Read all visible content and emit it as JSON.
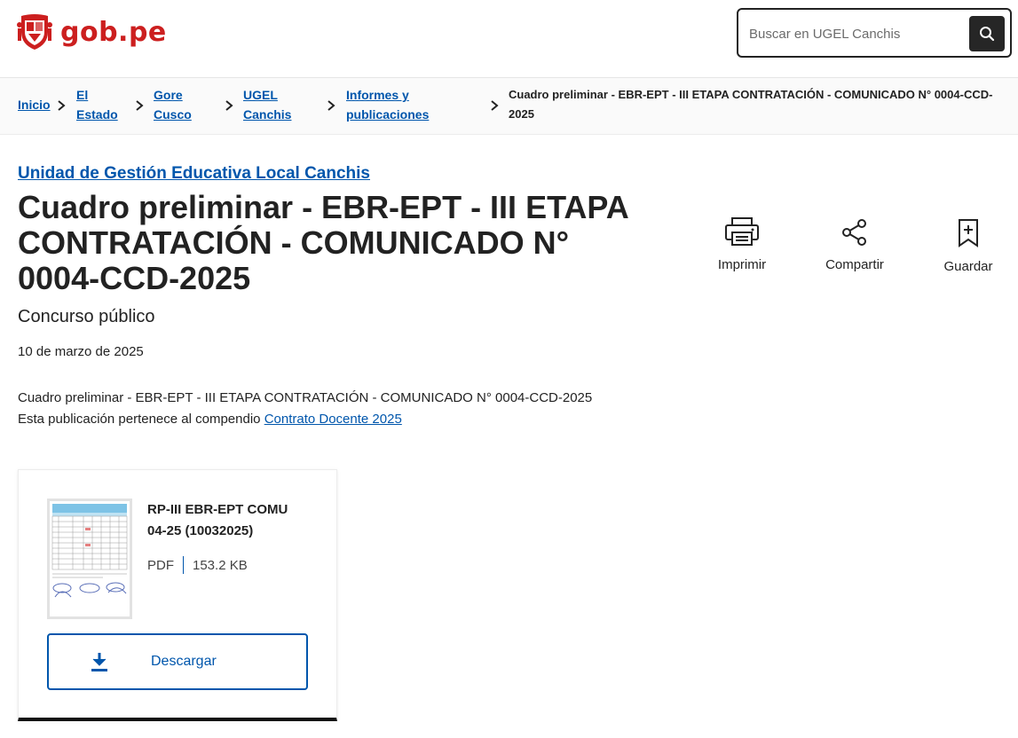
{
  "header": {
    "logo_text": "gob.pe",
    "search_placeholder": "Buscar en UGEL Canchis",
    "search_icon": "magnifier-icon"
  },
  "breadcrumb": {
    "items": [
      {
        "lines": [
          "Inicio"
        ]
      },
      {
        "lines": [
          "El",
          "Estado"
        ]
      },
      {
        "lines": [
          "Gore",
          "Cusco"
        ]
      },
      {
        "lines": [
          "UGEL",
          "Canchis"
        ]
      },
      {
        "lines": [
          "Informes y",
          "publicaciones"
        ]
      }
    ],
    "current": [
      "Cuadro preliminar - EBR-EPT - III ETAPA CONTRATACIÓN - COMUNICADO N° 0004-CCD-",
      "2025"
    ]
  },
  "main": {
    "agency": "Unidad de Gestión Educativa Local Canchis",
    "title_lines": [
      "Cuadro preliminar - EBR-EPT - III ETAPA",
      "CONTRATACIÓN - COMUNICADO N°",
      "0004-CCD-2025"
    ],
    "subtitle": "Concurso público",
    "date": "10 de marzo de 2025",
    "description": "Cuadro preliminar - EBR-EPT - III ETAPA CONTRATACIÓN - COMUNICADO N° 0004-CCD-2025",
    "compendium_prefix": "Esta publicación pertenece al compendio ",
    "compendium_link": "Contrato Docente 2025"
  },
  "actions": {
    "print": "Imprimir",
    "share": "Compartir",
    "save": "Guardar"
  },
  "file": {
    "name_lines": [
      "RP-III EBR-EPT COMU",
      "04-25 (10032025)"
    ],
    "type": "PDF",
    "size": "153.2 KB",
    "download_label": "Descargar"
  },
  "colors": {
    "link": "#0056ac",
    "brand_red": "#cc1f1f",
    "text": "#222222"
  }
}
